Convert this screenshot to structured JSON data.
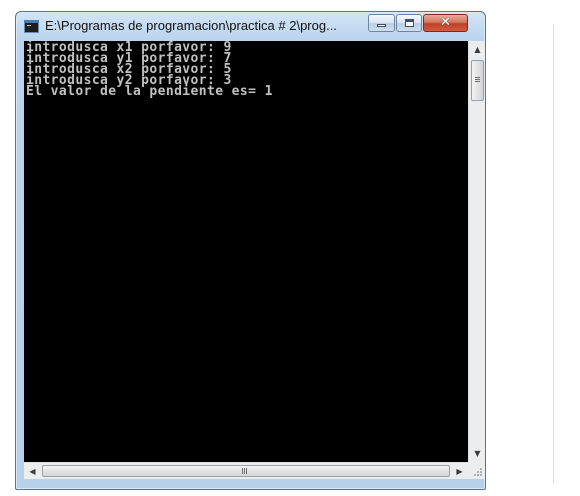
{
  "window": {
    "title": "E:\\Programas de programacion\\practica # 2\\prog..."
  },
  "titlebar": {
    "icon": "console-app-icon",
    "buttons": {
      "minimize": "minimize-icon",
      "maximize": "maximize-icon",
      "close": "close-icon",
      "close_glyph": "✕"
    }
  },
  "console": {
    "lines": [
      "introdusca x1 porfavor: 9",
      "introdusca y1 porfavor: 7",
      "introdusca x2 porfavor: 5",
      "introdusca y2 porfavor: 3",
      "El valor de la pendiente es= 1"
    ]
  },
  "scrollbars": {
    "up_arrow": "▲",
    "down_arrow": "▼",
    "left_arrow": "◀",
    "right_arrow": "▶"
  }
}
